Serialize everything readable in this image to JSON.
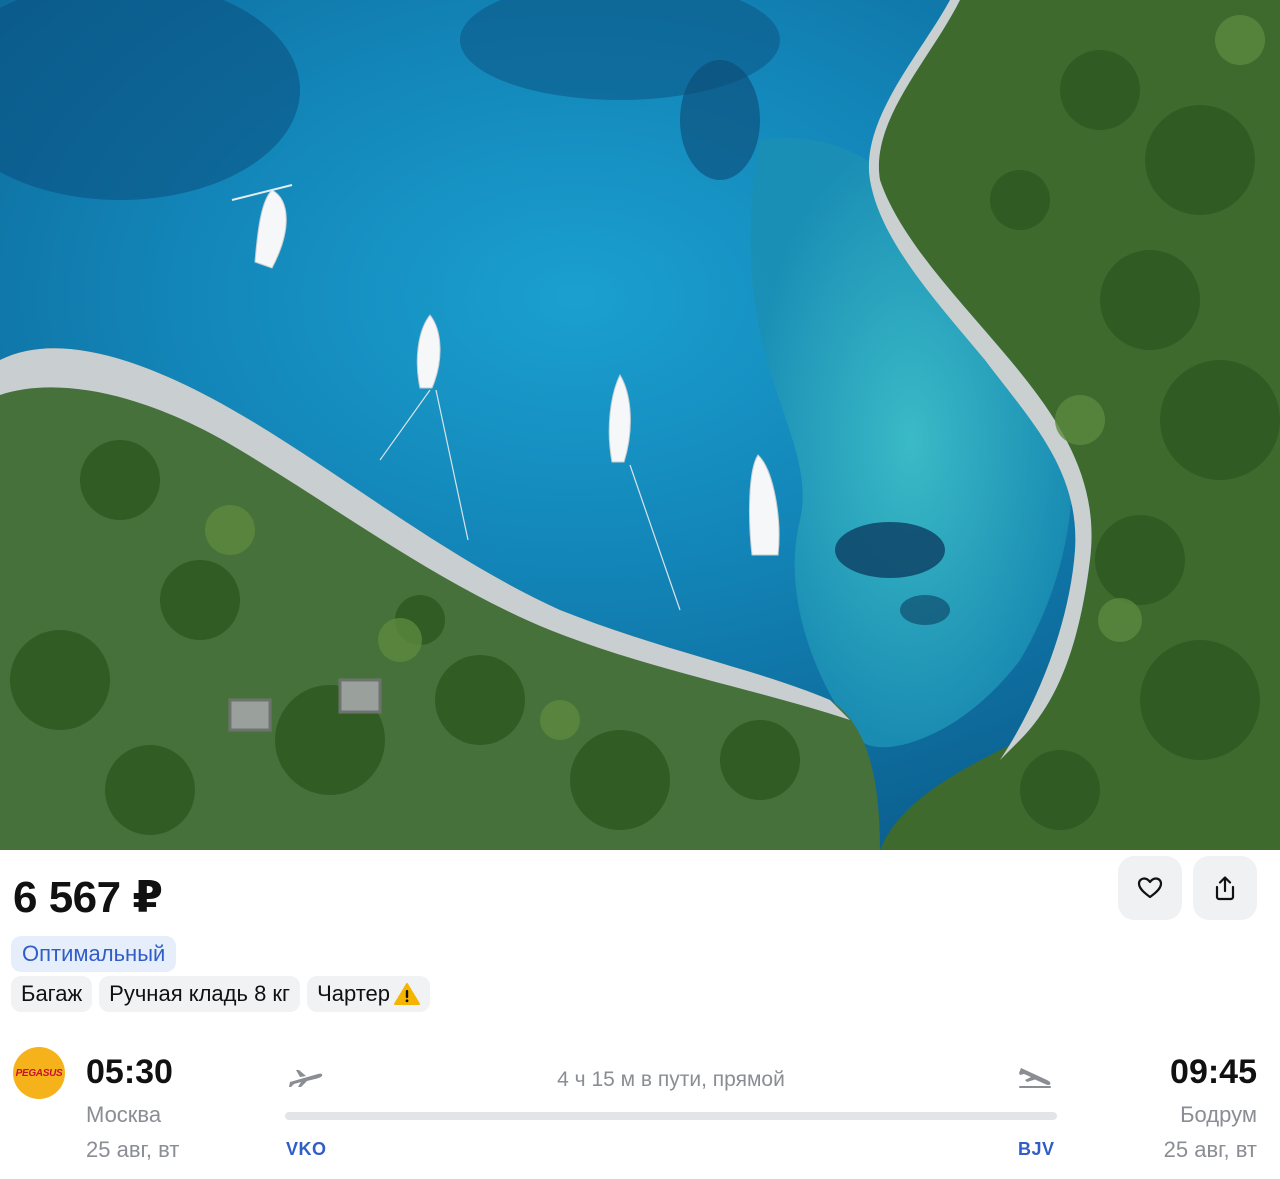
{
  "colors": {
    "accent": "#2f5fc6",
    "chip_bg": "#f1f2f4",
    "optimal_bg": "#e7eefb",
    "muted_text": "#8a8d93",
    "warning": "#f5b400",
    "airline_logo_bg": "#f6b21a"
  },
  "photo": {
    "subject": "aerial view of turquoise bay with boats",
    "icon": "photo"
  },
  "offer": {
    "price": "6 567 ₽",
    "badge": "Оптимальный",
    "tags": [
      "Багаж",
      "Ручная кладь 8 кг",
      "Чартер"
    ],
    "favorite_icon": "heart-icon",
    "share_icon": "share-icon",
    "warning_icon": "warning-icon"
  },
  "airline": {
    "logo_text": "PEGASUS"
  },
  "flight": {
    "departure": {
      "time": "05:30",
      "city": "Москва",
      "date": "25 авг, вт",
      "code": "VKO"
    },
    "arrival": {
      "time": "09:45",
      "city": "Бодрум",
      "date": "25 авг, вт",
      "code": "BJV"
    },
    "duration": "4 ч 15 м в пути, прямой"
  }
}
